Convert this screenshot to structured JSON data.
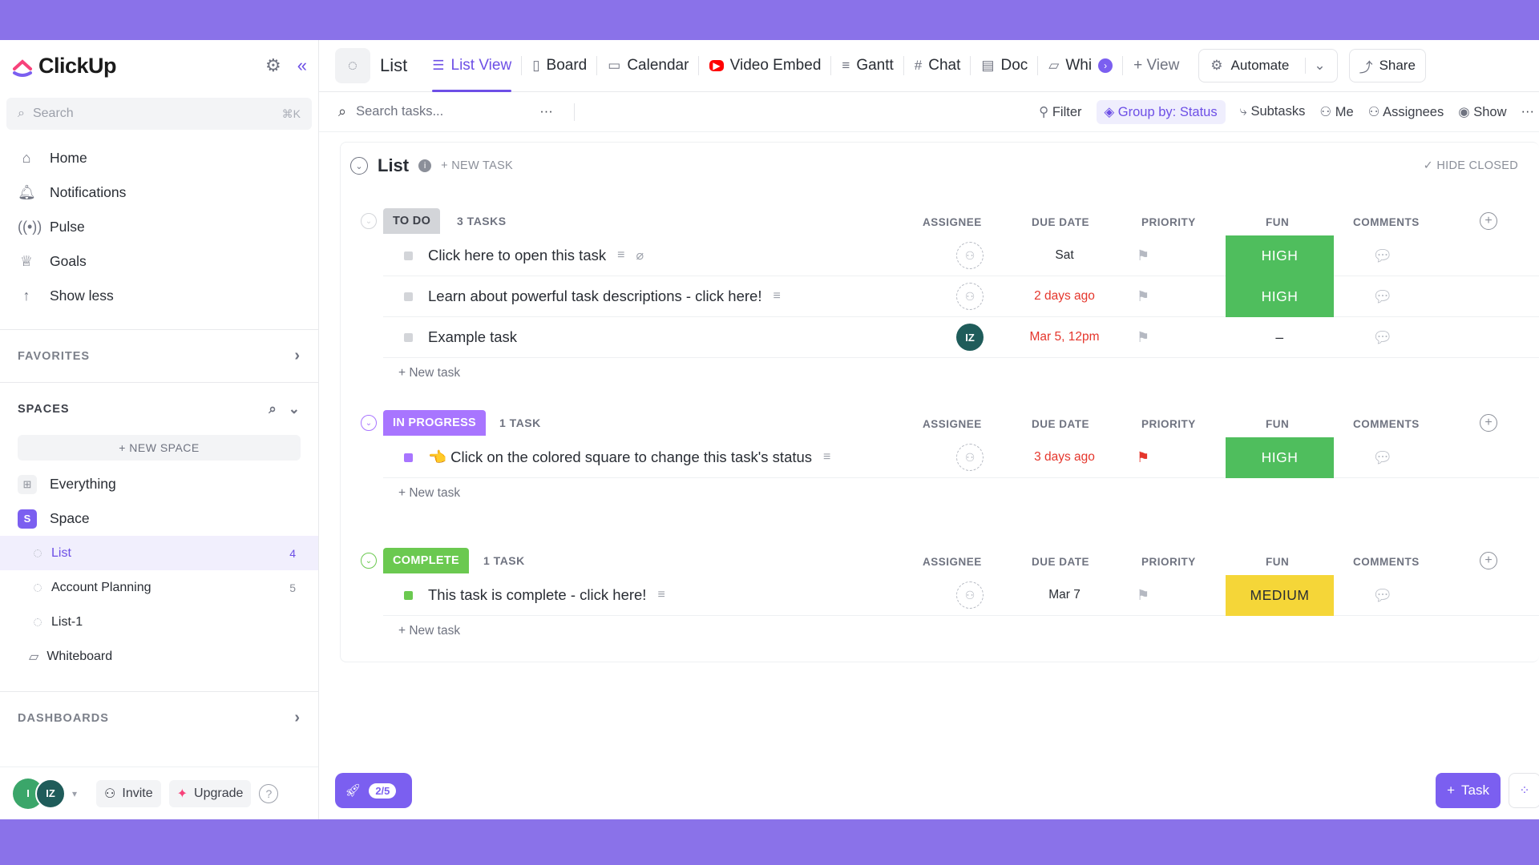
{
  "brand": {
    "name": "ClickUp",
    "accent": "#7b5ff0"
  },
  "sidebar": {
    "search_placeholder": "Search",
    "search_shortcut": "⌘K",
    "nav": [
      {
        "label": "Home",
        "icon": "home-icon"
      },
      {
        "label": "Notifications",
        "icon": "bell-icon"
      },
      {
        "label": "Pulse",
        "icon": "pulse-icon"
      },
      {
        "label": "Goals",
        "icon": "trophy-icon"
      },
      {
        "label": "Show less",
        "icon": "arrow-up-icon"
      }
    ],
    "favorites_label": "FAVORITES",
    "spaces_label": "SPACES",
    "new_space_label": "+ NEW SPACE",
    "everything_label": "Everything",
    "space": {
      "label": "Space",
      "letter": "S"
    },
    "lists": [
      {
        "label": "List",
        "count": "4"
      },
      {
        "label": "Account Planning",
        "count": "5"
      },
      {
        "label": "List-1",
        "count": ""
      }
    ],
    "whiteboard_label": "Whiteboard",
    "dashboards_label": "DASHBOARDS",
    "footer": {
      "avatar1": "I",
      "avatar2": "IZ",
      "invite_label": "Invite",
      "upgrade_label": "Upgrade",
      "help": "?"
    }
  },
  "topbar": {
    "list_label": "List",
    "tabs": [
      {
        "label": "List View",
        "icon": "list-icon"
      },
      {
        "label": "Board",
        "icon": "board-icon"
      },
      {
        "label": "Calendar",
        "icon": "calendar-icon"
      },
      {
        "label": "Video Embed",
        "icon": "youtube-icon"
      },
      {
        "label": "Gantt",
        "icon": "gantt-icon"
      },
      {
        "label": "Chat",
        "icon": "hash-icon"
      },
      {
        "label": "Doc",
        "icon": "doc-icon"
      },
      {
        "label": "Whi",
        "icon": "whiteboard-icon"
      }
    ],
    "add_view_label": "+ View",
    "automate_label": "Automate",
    "share_label": "Share"
  },
  "toolbar": {
    "search_placeholder": "Search tasks...",
    "filter_label": "Filter",
    "group_label": "Group by: Status",
    "subtasks_label": "Subtasks",
    "me_label": "Me",
    "assignees_label": "Assignees",
    "show_label": "Show"
  },
  "list": {
    "title": "List",
    "new_task_label": "+ NEW TASK",
    "hide_closed_label": "HIDE CLOSED",
    "columns": {
      "assignee": "ASSIGNEE",
      "due": "DUE DATE",
      "priority": "PRIORITY",
      "fun": "FUN",
      "comments": "COMMENTS"
    },
    "new_task_row_label": "+ New task",
    "groups": [
      {
        "status": "TO DO",
        "count": "3 TASKS",
        "color": "#d3d5d9",
        "tasks": [
          {
            "name": "Click here to open this task",
            "due": "Sat",
            "fun": "HIGH"
          },
          {
            "name": "Learn about powerful task descriptions - click here!",
            "due": "2 days ago",
            "fun": "HIGH"
          },
          {
            "name": "Example task",
            "due": "Mar 5, 12pm",
            "fun": "–",
            "assignee": "IZ"
          }
        ]
      },
      {
        "status": "IN PROGRESS",
        "count": "1 TASK",
        "color": "#a875ff",
        "tasks": [
          {
            "name": "👈 Click on the colored square to change this task's status",
            "due": "3 days ago",
            "fun": "HIGH"
          }
        ]
      },
      {
        "status": "COMPLETE",
        "count": "1 TASK",
        "color": "#6bc950",
        "tasks": [
          {
            "name": "This task is complete - click here!",
            "due": "Mar 7",
            "fun": "MEDIUM"
          }
        ]
      }
    ]
  },
  "fab": {
    "progress": "2/5",
    "task_label": "Task"
  }
}
